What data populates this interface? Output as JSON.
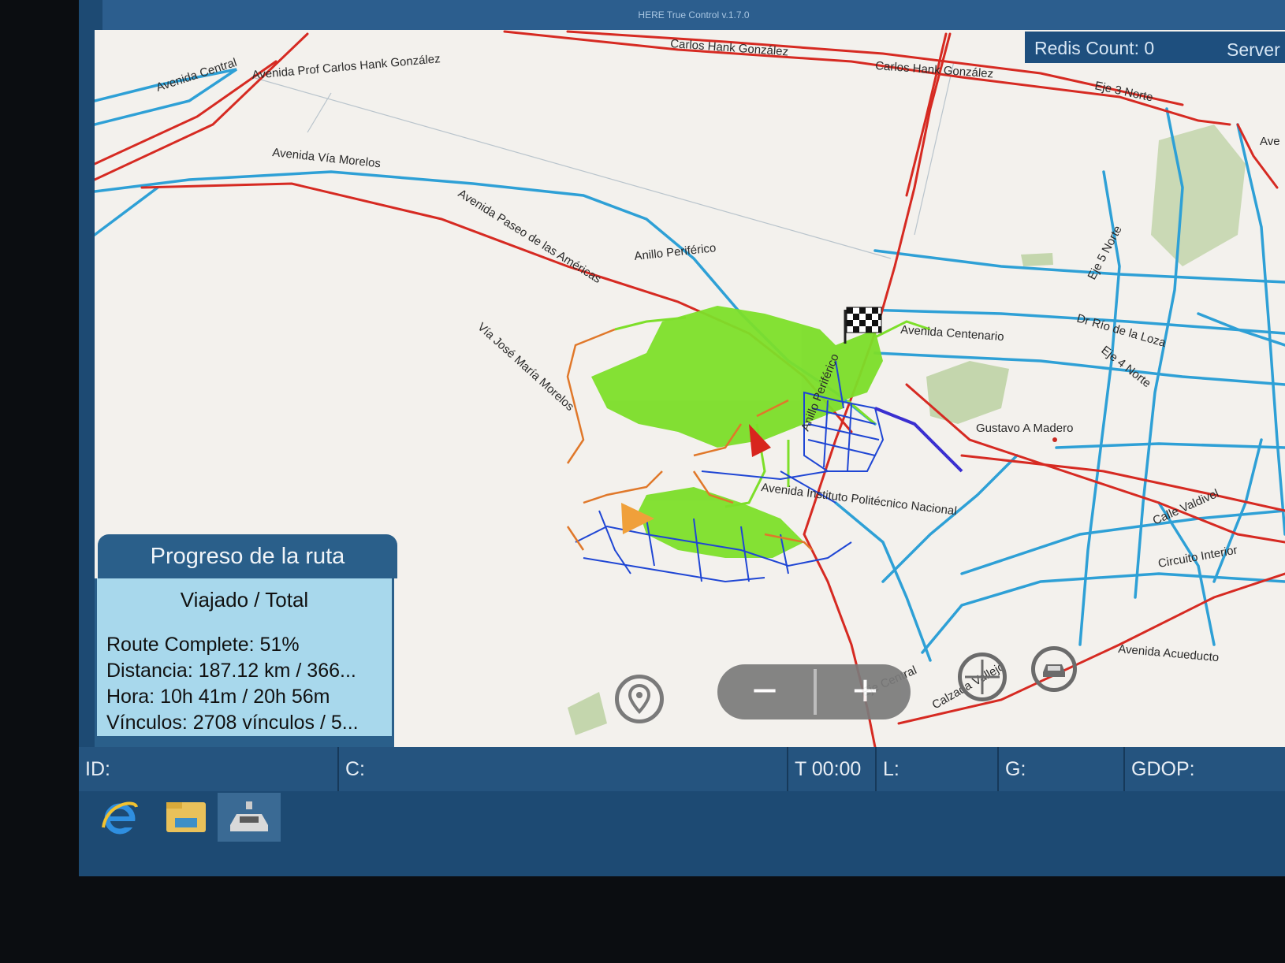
{
  "window": {
    "title": "HERE True Control v.1.7.0"
  },
  "header": {
    "redis_label": "Redis Count: 0",
    "server_label": "Server"
  },
  "map": {
    "streets": [
      "Carlos Hank González",
      "Carlos Hank González",
      "Avenida Central",
      "Avenida Prof Carlos Hank González",
      "Eje 3 Norte",
      "Avenida Vía Morelos",
      "Avenida Paseo de las Américas",
      "Anillo Periférico",
      "Eje 5 Norte",
      "Vía José María Morelos",
      "Avenida Centenario",
      "Dr Río de la Loza",
      "Eje 4 Norte",
      "Anillo Periférico",
      "Gustavo A Madero",
      "Avenida Instituto Politécnico Nacional",
      "Calle Valdivel",
      "Circuito Interior",
      "Avenida Acueducto",
      "Eje Central",
      "Calzada Vallejo",
      "Ave"
    ],
    "colors": {
      "road_red": "#d62a22",
      "road_cyan": "#2ea0d6",
      "travelled_green": "#7ddf2a",
      "route_blue": "#1f46d4",
      "unrouted_orange": "#e0782a",
      "park_green": "#b8cf9c"
    }
  },
  "controls": {
    "location_icon": "location-pin-icon",
    "zoom_out_label": "−",
    "zoom_in_label": "+",
    "compass_icon": "compass-icon",
    "car_icon": "car-icon"
  },
  "progress": {
    "title": "Progreso de la ruta",
    "subtitle": "Viajado / Total",
    "route_complete": "Route Complete: 51%",
    "distance": "Distancia: 187.12 km / 366...",
    "time": "Hora: 10h 41m / 20h 56m",
    "links": "Vínculos: 2708 vínculos / 5..."
  },
  "status": {
    "id_label": "ID:",
    "c_label": "C:",
    "t_label": "T 00:00",
    "l_label": "L:",
    "g_label": "G:",
    "gdop_label": "GDOP:"
  },
  "taskbar": {
    "items": [
      {
        "icon": "internet-explorer-icon"
      },
      {
        "icon": "file-explorer-icon"
      },
      {
        "icon": "true-control-car-icon"
      }
    ]
  }
}
